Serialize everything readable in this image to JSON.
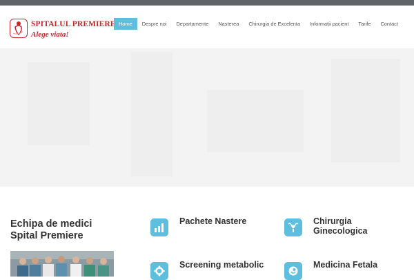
{
  "logo": {
    "name": "SPITALUL PREMIERE",
    "tagline": "Alege viata!"
  },
  "nav": {
    "items": [
      {
        "label": "Home",
        "active": true
      },
      {
        "label": "Despre noi",
        "active": false
      },
      {
        "label": "Departamente",
        "active": false
      },
      {
        "label": "Nasterea",
        "active": false
      },
      {
        "label": "Chirurgia de Excelenta",
        "active": false
      },
      {
        "label": "Informații pacient",
        "active": false
      },
      {
        "label": "Tarife",
        "active": false
      },
      {
        "label": "Contact",
        "active": false
      }
    ]
  },
  "team": {
    "title_line1": "Echipa de medici",
    "title_line2": "Spital Premiere"
  },
  "services": [
    {
      "label": "Pachete Nastere",
      "icon": "bar-chart-icon"
    },
    {
      "label": "Chirurgia\nGinecologica",
      "icon": "uterus-icon"
    },
    {
      "label": "Screening metabolic",
      "icon": "gear-icon"
    },
    {
      "label": "Medicina Fetala",
      "icon": "fetus-icon"
    }
  ],
  "colors": {
    "accent": "#5dbfdd",
    "brand_red": "#c9262c",
    "topbar": "#5f6468"
  }
}
